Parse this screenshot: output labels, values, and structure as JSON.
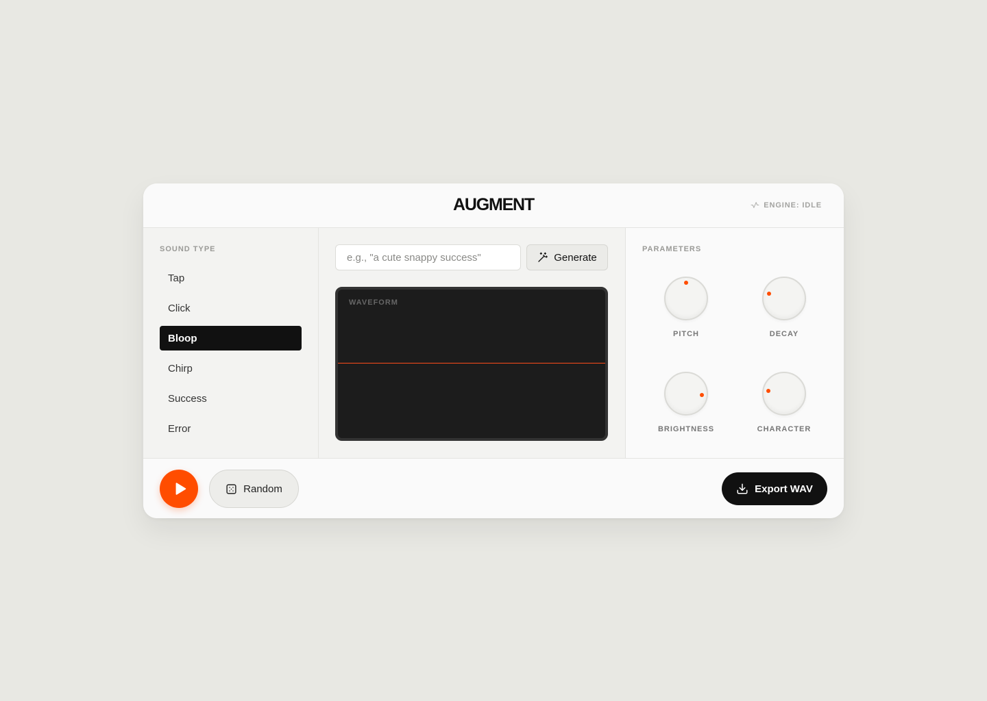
{
  "app": {
    "title": "AUGMENT",
    "engine_status": "ENGINE: IDLE"
  },
  "sidebar": {
    "section_label": "SOUND TYPE",
    "items": [
      {
        "label": "Tap",
        "active": false
      },
      {
        "label": "Click",
        "active": false
      },
      {
        "label": "Bloop",
        "active": true
      },
      {
        "label": "Chirp",
        "active": false
      },
      {
        "label": "Success",
        "active": false
      },
      {
        "label": "Error",
        "active": false
      }
    ]
  },
  "generator": {
    "placeholder": "e.g., \"a cute snappy success\"",
    "value": "",
    "generate_label": "Generate"
  },
  "waveform": {
    "label": "WAVEFORM"
  },
  "parameters": {
    "section_label": "PARAMETERS",
    "knobs": [
      {
        "label": "PITCH",
        "level": 0.5
      },
      {
        "label": "DECAY",
        "level": 0.23
      },
      {
        "label": "BRIGHTNESS",
        "level": 0.85
      },
      {
        "label": "CHARACTER",
        "level": 0.2
      }
    ]
  },
  "footer": {
    "random_label": "Random",
    "export_label": "Export WAV"
  },
  "colors": {
    "accent": "#ff4d00",
    "dark": "#111111",
    "background": "#e8e8e3"
  }
}
